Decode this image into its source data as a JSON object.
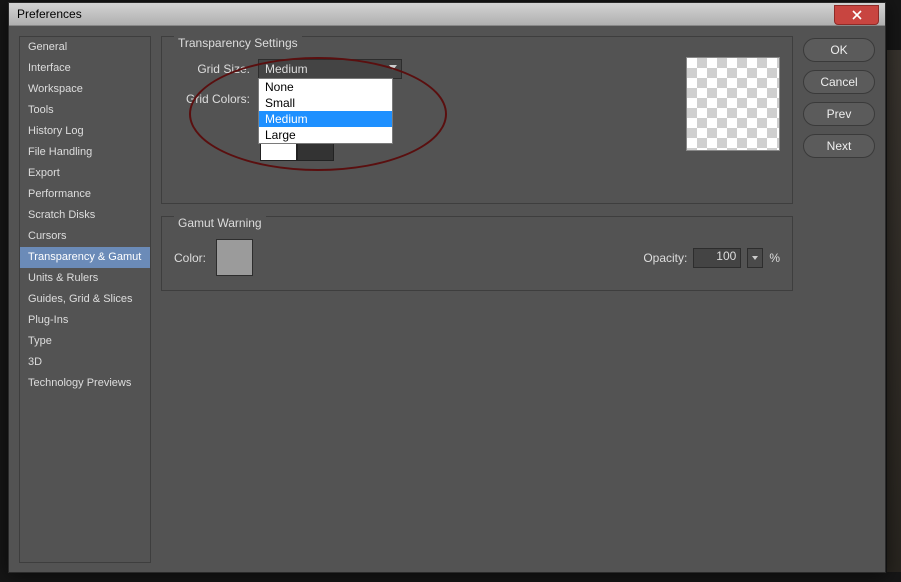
{
  "window": {
    "title": "Preferences"
  },
  "buttons": {
    "ok": "OK",
    "cancel": "Cancel",
    "prev": "Prev",
    "next": "Next"
  },
  "sidebar": {
    "items": [
      "General",
      "Interface",
      "Workspace",
      "Tools",
      "History Log",
      "File Handling",
      "Export",
      "Performance",
      "Scratch Disks",
      "Cursors",
      "Transparency & Gamut",
      "Units & Rulers",
      "Guides, Grid & Slices",
      "Plug-Ins",
      "Type",
      "3D",
      "Technology Previews"
    ],
    "selected_index": 10
  },
  "transparency": {
    "group_label": "Transparency Settings",
    "grid_size_label": "Grid Size:",
    "grid_size_value": "Medium",
    "grid_size_options": [
      "None",
      "Small",
      "Medium",
      "Large"
    ],
    "grid_colors_label": "Grid Colors:"
  },
  "gamut": {
    "group_label": "Gamut Warning",
    "color_label": "Color:",
    "opacity_label": "Opacity:",
    "opacity_value": "100",
    "opacity_suffix": "%"
  }
}
